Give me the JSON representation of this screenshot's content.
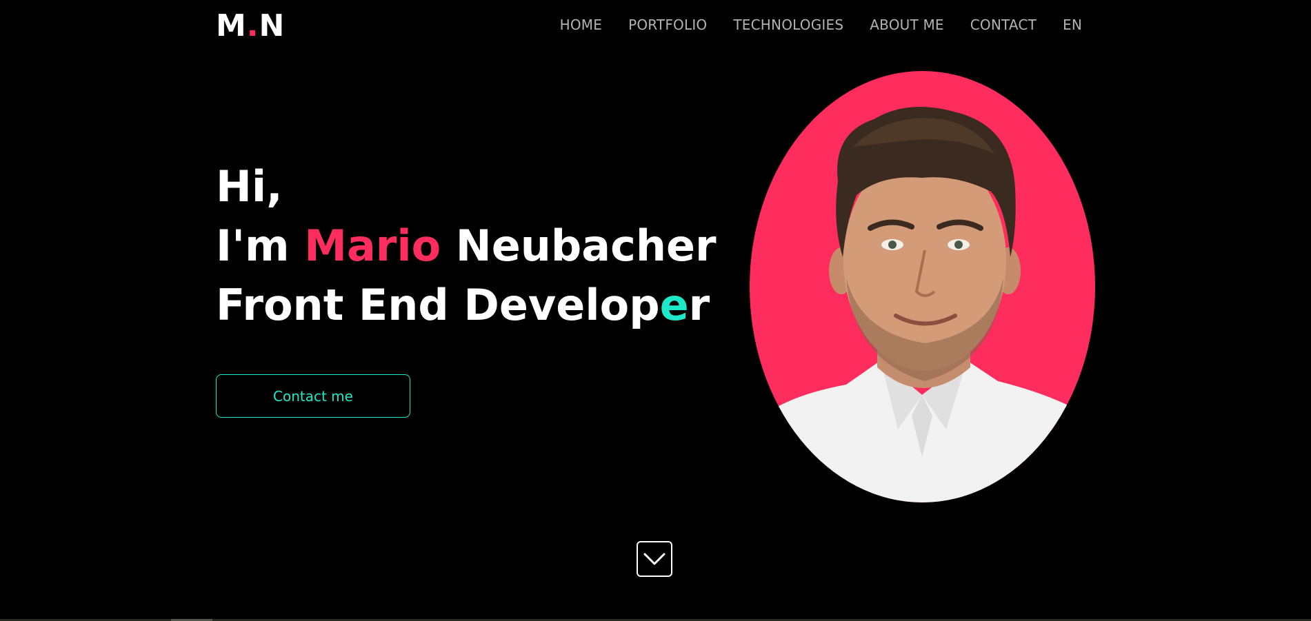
{
  "logo": {
    "left": "M",
    "dot": ".",
    "right": "N"
  },
  "nav": {
    "home": "HOME",
    "portfolio": "PORTFOLIO",
    "technologies": "TECHNOLOGIES",
    "about": "ABOUT ME",
    "contact": "CONTACT",
    "language": "EN"
  },
  "hero": {
    "greeting": "Hi,",
    "intro_prefix": "I'm ",
    "first_name": "Mario",
    "last_name": " Neubacher",
    "role_start": "Front End Develop",
    "role_accent": "e",
    "role_end": "r",
    "cta_label": "Contact me"
  },
  "portrait": {
    "alt": "Mario Neubacher portrait"
  },
  "colors": {
    "background": "#000000",
    "accent_red": "#ff2d5e",
    "accent_teal": "#1de9c8",
    "nav_text": "#b3b3b3"
  },
  "icons": {
    "scroll": "chevron-down-icon"
  }
}
